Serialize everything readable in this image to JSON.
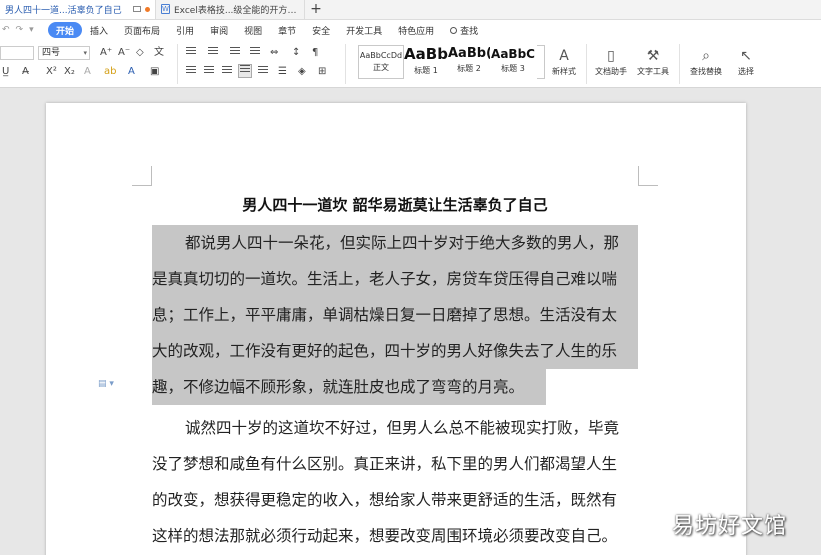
{
  "tabs": [
    {
      "label": "男人四十一道...活辜负了自己",
      "active": true
    },
    {
      "label": "Excel表格技...级全能的开方公式",
      "active": false
    }
  ],
  "menu": [
    "开始",
    "插入",
    "页面布局",
    "引用",
    "审阅",
    "视图",
    "章节",
    "安全",
    "开发工具",
    "特色应用"
  ],
  "menu_search": "查找",
  "ribbon": {
    "font_size": "四号",
    "styles": [
      {
        "sample": "AaBbCcDd",
        "name": "正文"
      },
      {
        "sample": "AaBb",
        "name": "标题 1"
      },
      {
        "sample": "AaBb(",
        "name": "标题 2"
      },
      {
        "sample": "AaBbC",
        "name": "标题 3"
      }
    ],
    "new_style": "新样式",
    "text_assistant": "文档助手",
    "text_tools": "文字工具",
    "find_replace": "查找替换",
    "select": "选择"
  },
  "document": {
    "title": "男人四十一道坎  韶华易逝莫让生活辜负了自己",
    "lines": [
      "都说男人四十一朵花，但实际上四十岁对于绝大多数的男人，那",
      "是真真切切的一道坎。生活上，老人子女，房贷车贷压得自己难以喘",
      "息；工作上，平平庸庸，单调枯燥日复一日磨掉了思想。生活没有太",
      "大的改观，工作没有更好的起色，四十岁的男人好像失去了人生的乐",
      "趣，不修边幅不顾形象，就连肚皮也成了弯弯的月亮。",
      "诚然四十岁的这道坎不好过，但男人么总不能被现实打败，毕竟",
      "没了梦想和咸鱼有什么区别。真正来讲，私下里的男人们都渴望人生",
      "的改变，想获得更稳定的收入，想给家人带来更舒适的生活，既然有",
      "这样的想法那就必须行动起来，想要改变周围环境必须要改变自己。"
    ]
  },
  "watermark": "易坊好文馆",
  "colors": {
    "accent": "#4a8af4",
    "highlight": "#c6c6c6"
  }
}
